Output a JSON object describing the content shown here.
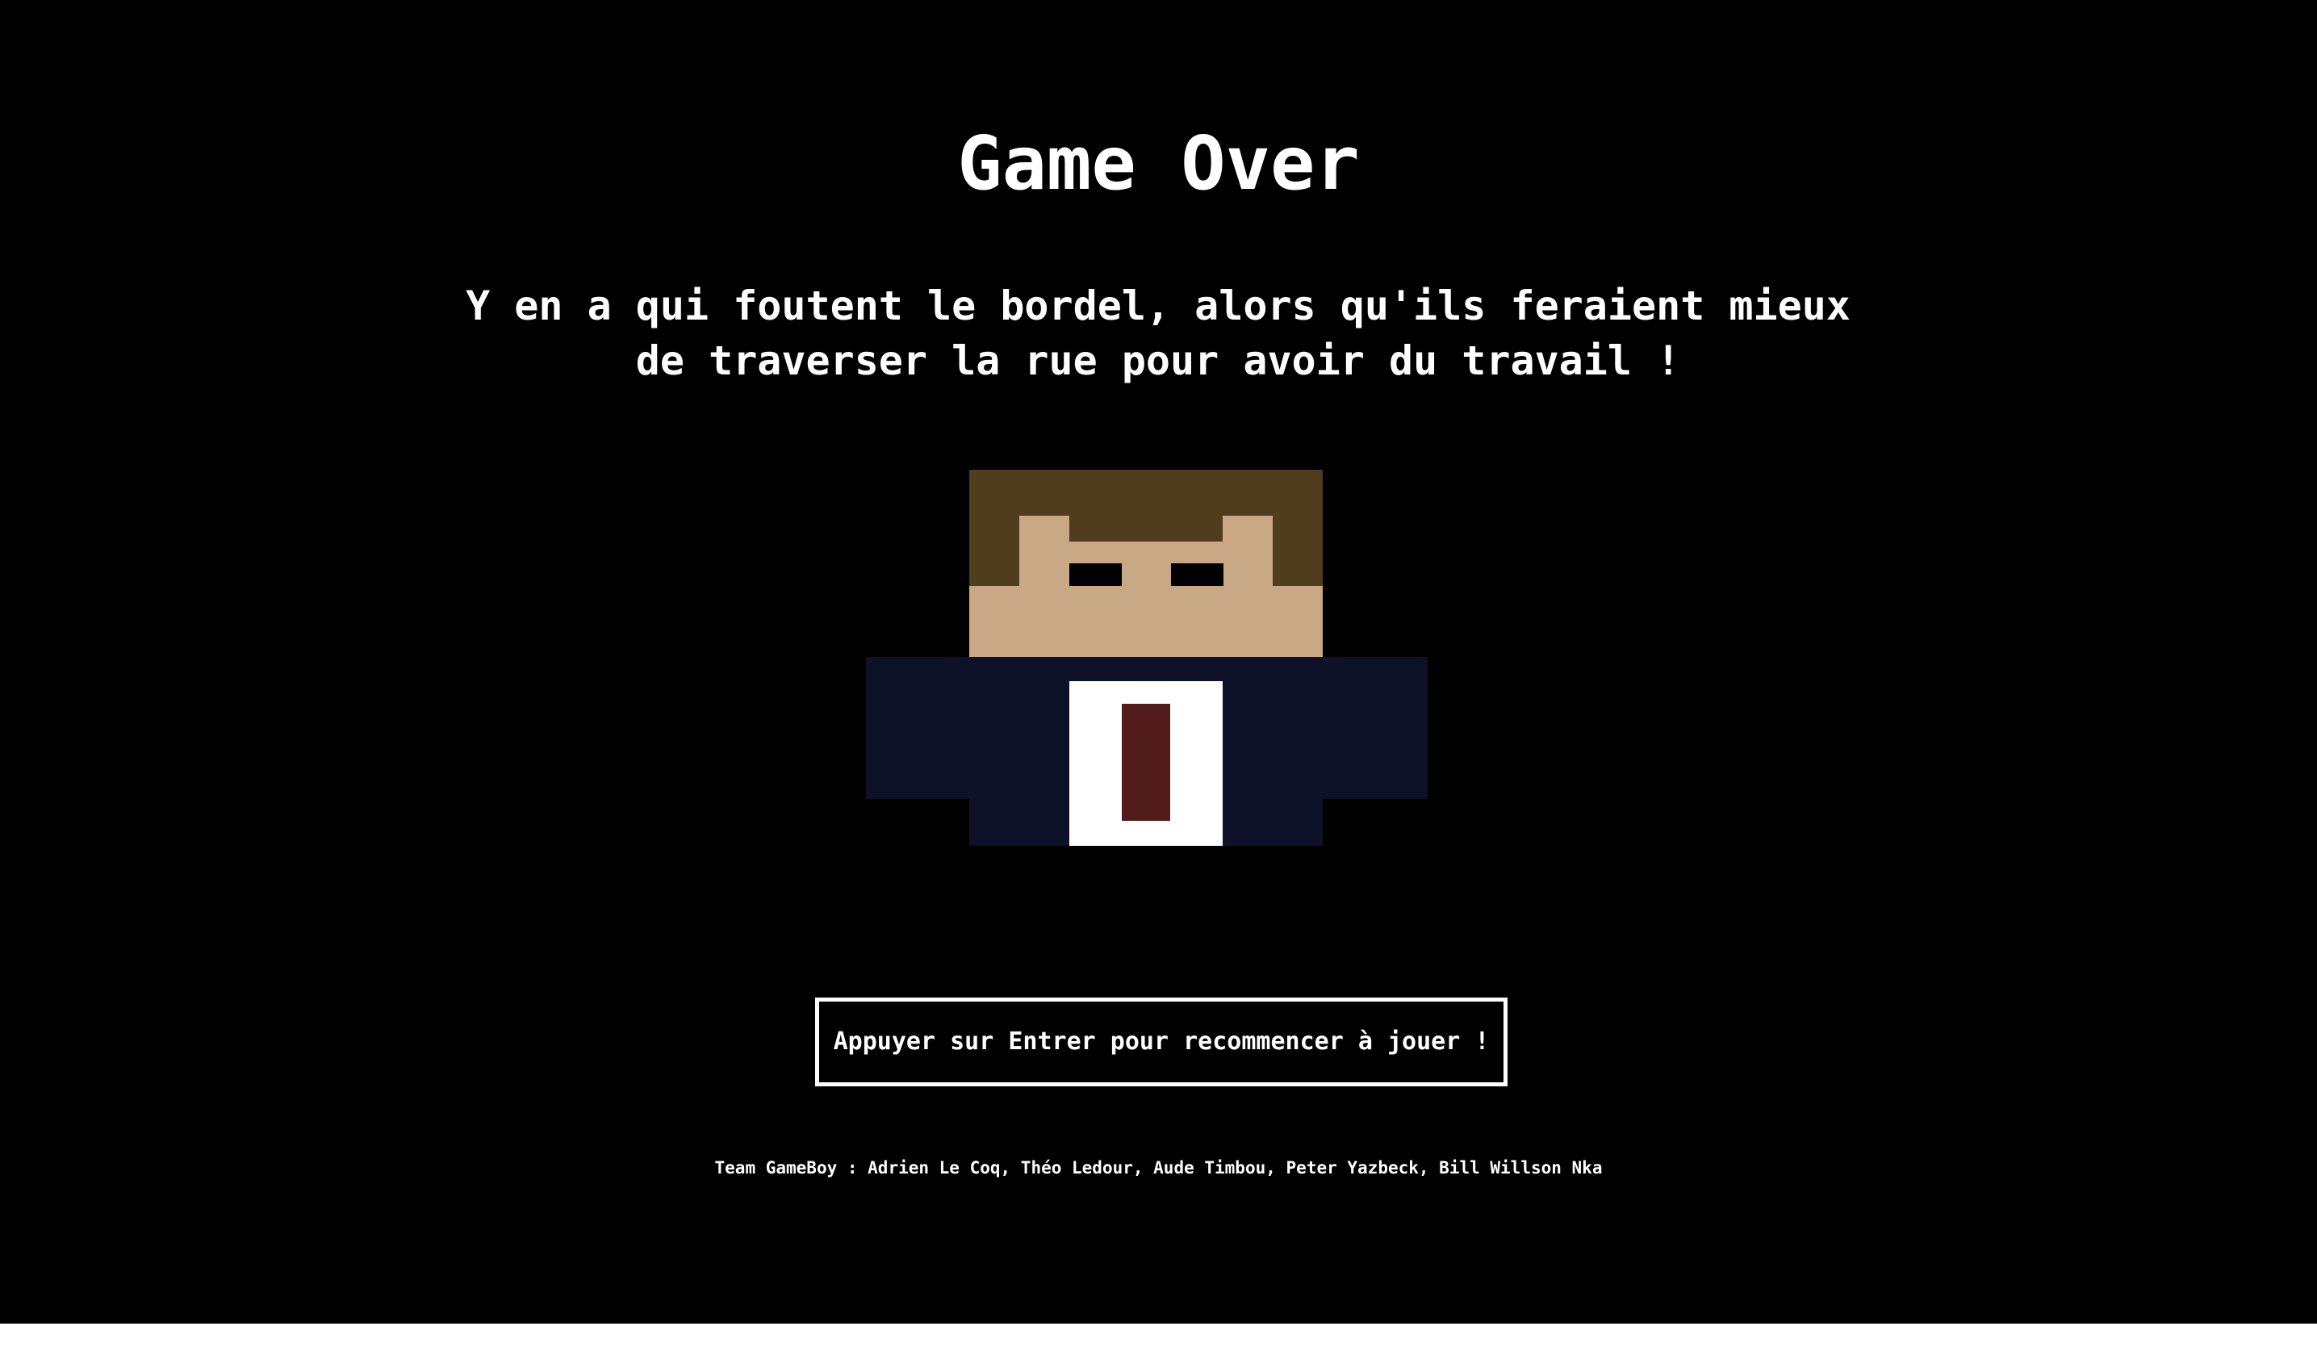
{
  "screen": {
    "title": "Game Over",
    "quote_line1": "Y en a qui foutent le bordel, alors qu'ils feraient mieux",
    "quote_line2": "de traverser la rue pour avoir du travail !",
    "restart_prompt": "Appuyer sur Entrer pour recommencer à jouer !",
    "credits": "Team GameBoy : Adrien Le Coq, Théo Ledour, Aude Timbou, Peter Yazbeck, Bill Willson Nka"
  },
  "colors": {
    "background": "#000000",
    "text": "#ffffff",
    "hair": "#4f3d1d",
    "skin": "#c9a985",
    "eyes": "#000000",
    "suit": "#0e1228",
    "shirt": "#ffffff",
    "tie": "#521b1b"
  },
  "character": {
    "name": "pixel-character",
    "icon": "pixel-businessman-icon"
  }
}
